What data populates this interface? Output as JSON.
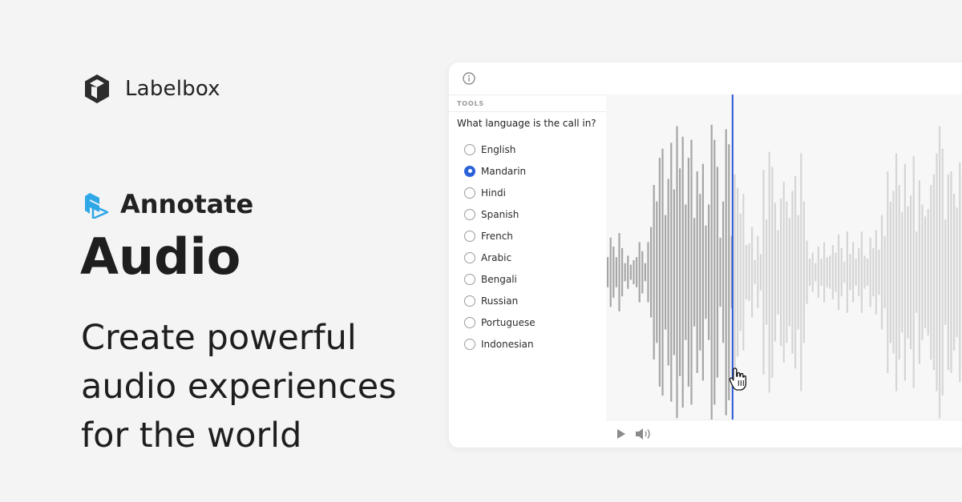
{
  "brand": {
    "name": "Labelbox",
    "logo_icon": "labelbox-cube-icon"
  },
  "product": {
    "name": "Annotate",
    "icon": "annotate-icon",
    "accent": "#2fa8e8"
  },
  "headline": "Audio",
  "tagline": [
    "Create powerful",
    "audio experiences",
    "for the world"
  ],
  "panel": {
    "info_icon": "info-icon",
    "tools_label": "TOOLS",
    "question": "What language is the call in?",
    "options": [
      {
        "label": "English",
        "selected": false
      },
      {
        "label": "Mandarin",
        "selected": true
      },
      {
        "label": "Hindi",
        "selected": false
      },
      {
        "label": "Spanish",
        "selected": false
      },
      {
        "label": "French",
        "selected": false
      },
      {
        "label": "Arabic",
        "selected": false
      },
      {
        "label": "Bengali",
        "selected": false
      },
      {
        "label": "Russian",
        "selected": false
      },
      {
        "label": "Portuguese",
        "selected": false
      },
      {
        "label": "Indonesian",
        "selected": false
      }
    ],
    "waveform": {
      "amplitudes": [
        0.1,
        0.23,
        0.17,
        0.1,
        0.26,
        0.16,
        0.06,
        0.11,
        0.05,
        0.08,
        0.1,
        0.2,
        0.14,
        0.06,
        0.2,
        0.3,
        0.58,
        0.47,
        0.76,
        0.82,
        0.38,
        0.62,
        0.86,
        0.55,
        0.97,
        0.69,
        0.9,
        0.45,
        0.76,
        0.88,
        0.36,
        0.67,
        0.52,
        0.72,
        0.31,
        0.45,
        0.98,
        0.88,
        0.7,
        0.23,
        0.47,
        0.95,
        0.85,
        0.24,
        0.65,
        0.56,
        0.39,
        0.52,
        0.18,
        0.19,
        0.3,
        0.08,
        0.24,
        0.12,
        0.68,
        0.35,
        0.8,
        0.7,
        0.46,
        0.28,
        0.49,
        0.6,
        0.47,
        0.36,
        0.54,
        0.64,
        0.38,
        0.79,
        0.47,
        0.21,
        0.09,
        0.13,
        0.06,
        0.17,
        0.09,
        0.2,
        0.1,
        0.11,
        0.18,
        0.13,
        0.25,
        0.16,
        0.07,
        0.27,
        0.12,
        0.2,
        0.09,
        0.16,
        0.27,
        0.11,
        0.09,
        0.23,
        0.16,
        0.28,
        0.15,
        0.38,
        0.24,
        0.67,
        0.47,
        0.54,
        0.79,
        0.58,
        0.4,
        0.72,
        0.44,
        0.51,
        0.77,
        0.27,
        0.61,
        0.45,
        0.37,
        0.42,
        0.58,
        0.65,
        0.79,
        0.97,
        0.82,
        0.35,
        0.65,
        0.67,
        0.52,
        0.43,
        0.73,
        0.66,
        0.48,
        0.8
      ],
      "playhead": 0.34,
      "played_color": "#a6a6a6",
      "unplayed_color": "#d5d5d5",
      "playhead_color": "#2a56d6"
    },
    "controls": {
      "play_icon": "play-icon",
      "volume_icon": "volume-icon"
    }
  }
}
